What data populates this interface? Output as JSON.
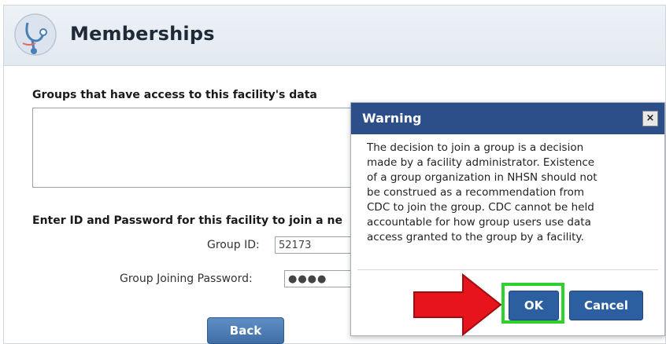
{
  "header": {
    "title": "Memberships",
    "logo_icon": "stethoscope-icon"
  },
  "groups_section": {
    "label": "Groups that have access to this facility's data"
  },
  "join_section": {
    "label": "Enter ID and Password for this facility to join a ne",
    "group_id_label": "Group ID:",
    "group_id_value": "52173",
    "password_label": "Group Joining Password:",
    "password_value": "●●●●"
  },
  "back_button": {
    "label": "Back"
  },
  "dialog": {
    "title": "Warning",
    "close_label": "×",
    "message_lines": [
      "The decision to join a group is a decision",
      "made by a facility administrator. Existence",
      "of a group organization in NHSN should not",
      "be construed as a recommendation from",
      "CDC to join the group. CDC cannot be held",
      "accountable for how group users use data",
      "access granted to the group by a facility."
    ],
    "ok_label": "OK",
    "cancel_label": "Cancel"
  },
  "annotation": {
    "arrow_color": "#e8141c",
    "highlight_color": "#2ed12e"
  }
}
